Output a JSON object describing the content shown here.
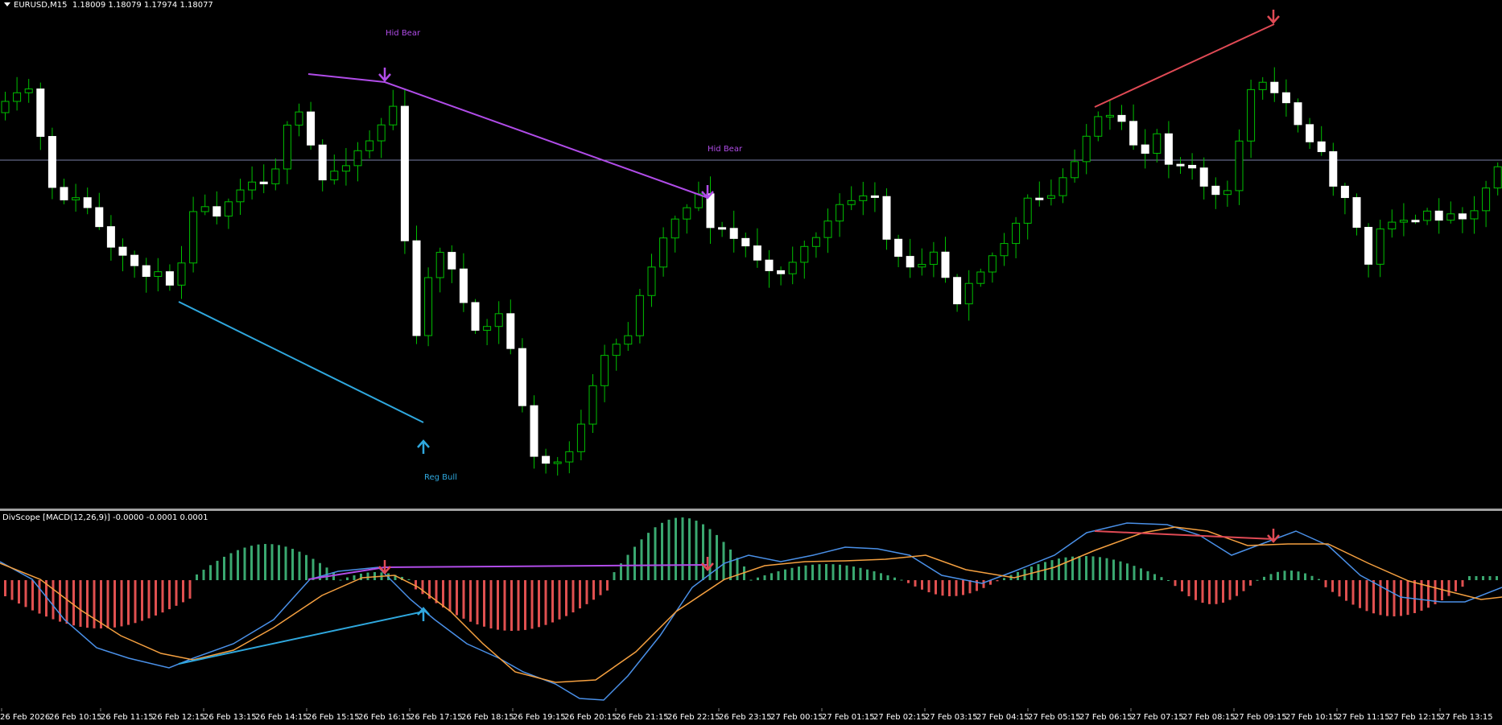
{
  "main_header": {
    "symbol": "EURUSD,M15",
    "ohlc": "1.18009 1.18079 1.17974 1.18077"
  },
  "sub_header": {
    "label": "DivScope [MACD(12,26,9)] -0.0000 -0.0001 0.0001"
  },
  "annotations": [
    {
      "id": "hidbear1",
      "text": "Hid Bear",
      "color": "#b04ce8"
    },
    {
      "id": "hidbear2",
      "text": "Hid Bear",
      "color": "#b04ce8"
    },
    {
      "id": "regbull",
      "text": "Reg Bull",
      "color": "#2fa8de"
    }
  ],
  "x_axis": [
    "26 Feb 2026",
    "26 Feb 10:15",
    "26 Feb 11:15",
    "26 Feb 12:15",
    "26 Feb 13:15",
    "26 Feb 14:15",
    "26 Feb 15:15",
    "26 Feb 16:15",
    "26 Feb 17:15",
    "26 Feb 18:15",
    "26 Feb 19:15",
    "26 Feb 20:15",
    "26 Feb 21:15",
    "26 Feb 22:15",
    "26 Feb 23:15",
    "27 Feb 00:15",
    "27 Feb 01:15",
    "27 Feb 02:15",
    "27 Feb 03:15",
    "27 Feb 04:15",
    "27 Feb 05:15",
    "27 Feb 06:15",
    "27 Feb 07:15",
    "27 Feb 08:15",
    "27 Feb 09:15",
    "27 Feb 10:15",
    "27 Feb 11:15",
    "27 Feb 12:15",
    "27 Feb 13:15"
  ],
  "colors": {
    "bull_wick": "#00c000",
    "bear_body": "#ffffff",
    "price_line": "#7a7fa8",
    "macd": "#4a90e8",
    "signal": "#f5a040",
    "hist_pos": "#3aa870",
    "hist_neg": "#e05050",
    "hid_bear": "#b04ce8",
    "reg_bear": "#e04a55",
    "reg_bull": "#2fa8de"
  }
}
